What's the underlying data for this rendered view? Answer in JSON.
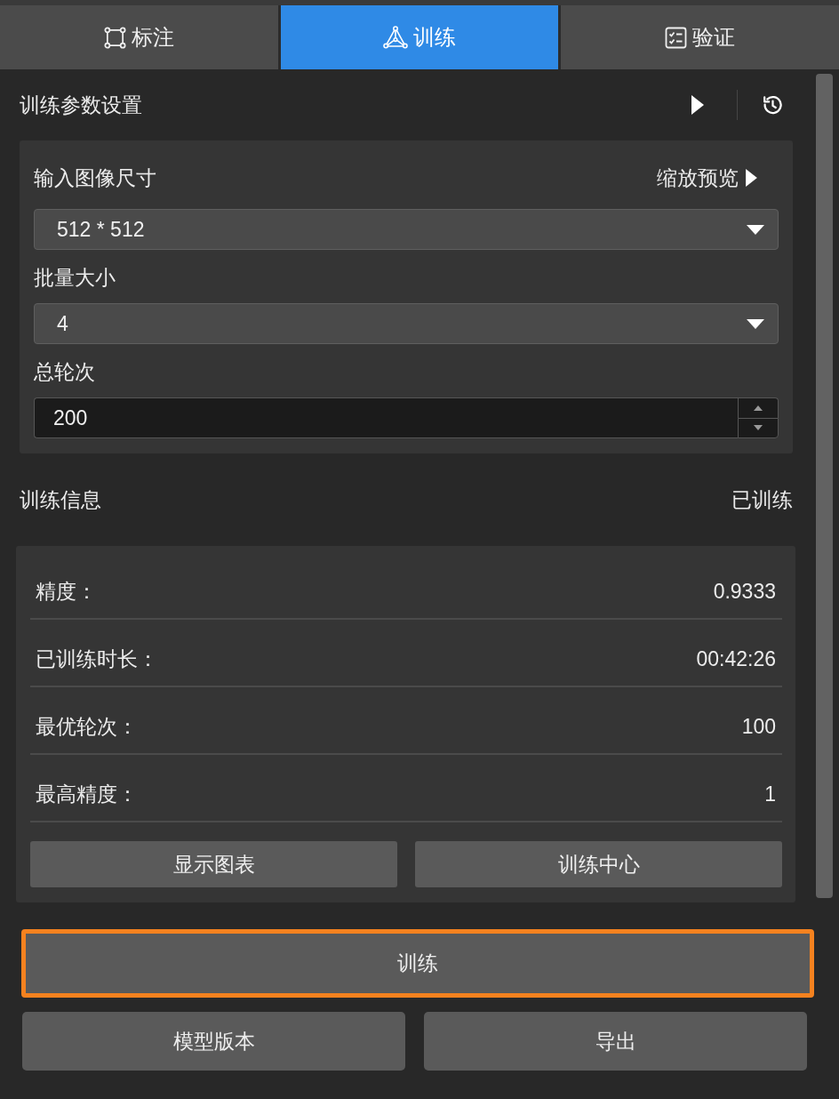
{
  "tabs": [
    {
      "label": "标注",
      "selected": false
    },
    {
      "label": "训练",
      "selected": true
    },
    {
      "label": "验证",
      "selected": false
    }
  ],
  "settings": {
    "title": "训练参数设置",
    "fields": [
      {
        "kind": "select",
        "label": "输入图像尺寸",
        "preview_toggle": "缩放预览",
        "value": "512 * 512"
      },
      {
        "kind": "select",
        "label": "批量大小",
        "value": "4"
      },
      {
        "kind": "number",
        "label": "总轮次",
        "value": "200"
      }
    ]
  },
  "info": {
    "title": "训练信息",
    "status": "已训练",
    "rows": [
      {
        "label": "精度：",
        "value": "0.9333"
      },
      {
        "label": "已训练时长：",
        "value": "00:42:26"
      },
      {
        "label": "最优轮次：",
        "value": "100"
      },
      {
        "label": "最高精度：",
        "value": "1"
      }
    ],
    "buttons": [
      "显示图表",
      "训练中心"
    ]
  },
  "train_button": {
    "label": "训练",
    "focused": true
  },
  "footer_buttons": [
    "模型版本",
    "导出"
  ]
}
